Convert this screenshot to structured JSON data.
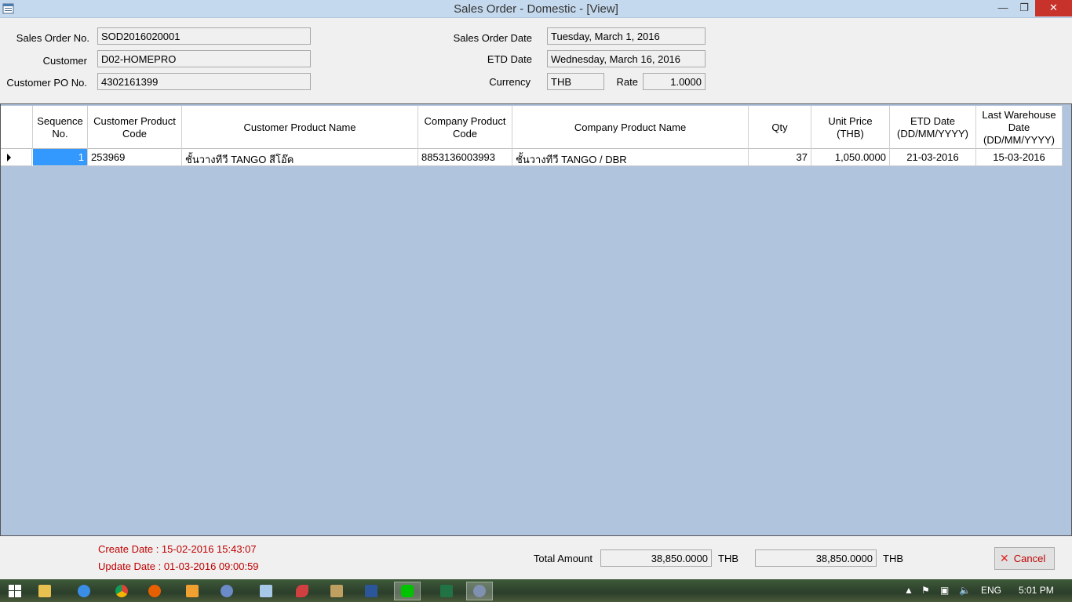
{
  "window": {
    "title": "Sales Order - Domestic - [View]",
    "minimize_glyph": "—",
    "maximize_glyph": "❐",
    "close_glyph": "✕"
  },
  "form": {
    "sales_order_no_label": "Sales Order No.",
    "sales_order_no": "SOD2016020001",
    "customer_label": "Customer",
    "customer": "D02-HOMEPRO",
    "customer_po_label": "Customer PO No.",
    "customer_po": "4302161399",
    "sales_order_date_label": "Sales Order Date",
    "sales_order_date": "Tuesday, March 1, 2016",
    "etd_date_label": "ETD Date",
    "etd_date": "Wednesday, March 16, 2016",
    "currency_label": "Currency",
    "currency": "THB",
    "rate_label": "Rate",
    "rate": "1.0000"
  },
  "grid": {
    "columns": [
      "Sequence No.",
      "Customer Product Code",
      "Customer Product Name",
      "Company Product Code",
      "Company Product Name",
      "Qty",
      "Unit Price (THB)",
      "ETD Date (DD/MM/YYYY)",
      "Last Warehouse Date (DD/MM/YYYY)"
    ],
    "rows": [
      {
        "seq": "1",
        "cust_code": "253969",
        "cust_name": "ชั้นวางทีวี TANGO สีโอ๊ค",
        "comp_code": "8853136003993",
        "comp_name": "ชั้นวางทีวี TANGO / DBR",
        "qty": "37",
        "unit_price": "1,050.0000",
        "etd": "21-03-2016",
        "last_wh": "15-03-2016"
      }
    ]
  },
  "footer": {
    "create_date": "Create Date : 15-02-2016 15:43:07",
    "update_date": "Update Date : 01-03-2016 09:00:59",
    "total_label": "Total Amount",
    "total_1": "38,850.0000",
    "currency_1": "THB",
    "total_2": "38,850.0000",
    "currency_2": "THB",
    "cancel_label": "Cancel"
  },
  "taskbar": {
    "language": "ENG",
    "clock": "5:01 PM"
  }
}
